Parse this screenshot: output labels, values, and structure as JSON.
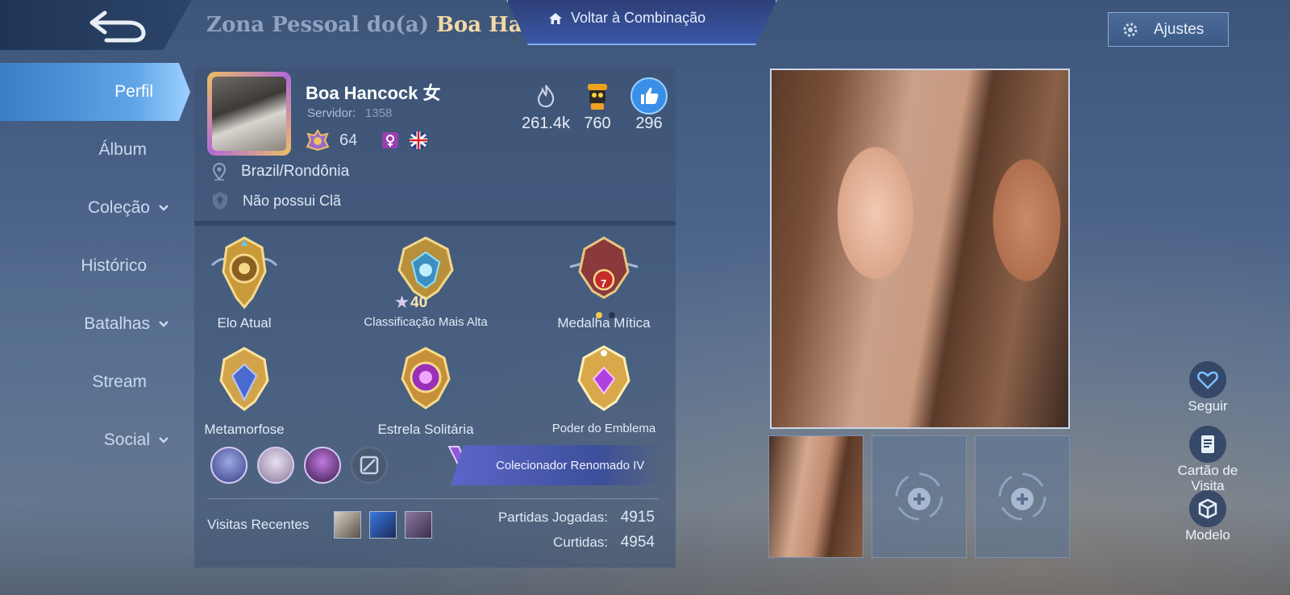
{
  "header": {
    "title_prefix": "Zona Pessoal do(a) ",
    "title_name": "Boa Hanco",
    "combo_label": "Voltar à Combinação",
    "settings_label": "Ajustes"
  },
  "nav": {
    "items": [
      {
        "label": "Perfil",
        "active": true
      },
      {
        "label": "Álbum"
      },
      {
        "label": "Coleção"
      },
      {
        "label": "Histórico"
      },
      {
        "label": "Batalhas"
      },
      {
        "label": "Stream"
      },
      {
        "label": "Social"
      }
    ]
  },
  "profile": {
    "name": "Boa Hancock 女",
    "server_label": "Servidor:",
    "server_id": "1358",
    "level": "64",
    "location": "Brazil/Rondônia",
    "clan": "Não possui Clã",
    "stats": {
      "popularity": "261.4k",
      "charm": "760",
      "likes": "296"
    }
  },
  "medals": [
    {
      "caption": "Elo Atual"
    },
    {
      "caption": "Classificação Mais Alta",
      "stars": "40"
    },
    {
      "caption": "Medalha Mítica",
      "rank": "7"
    },
    {
      "caption": "Metamorfose"
    },
    {
      "caption": "Estrela Solitária"
    },
    {
      "caption": "Poder do Emblema"
    }
  ],
  "collector": {
    "label": "Colecionador Renomado IV"
  },
  "recent": {
    "label": "Visitas Recentes"
  },
  "game_stats": {
    "matches_label": "Partidas Jogadas:",
    "matches_value": "4915",
    "likes_label": "Curtidas:",
    "likes_value": "4954"
  },
  "actions": {
    "follow": "Seguir",
    "card": "Cartão de Visita",
    "model": "Modelo"
  },
  "colors": {
    "accent_blue": "#5ea4e6",
    "gold_name": "#f1d9a6",
    "like_button": "#3a90e8"
  }
}
